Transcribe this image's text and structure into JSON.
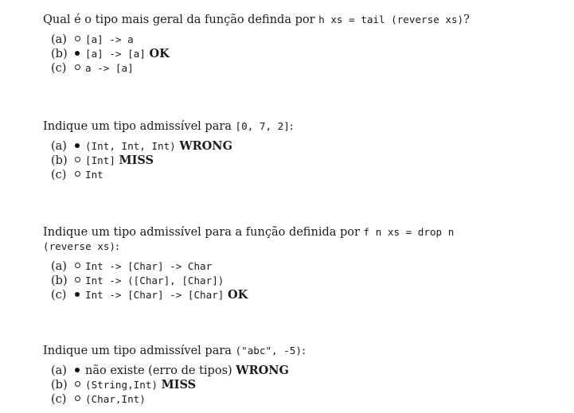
{
  "questions": [
    {
      "stem_text": "Qual é o tipo mais geral da função definda por ",
      "stem_code": "h xs = tail (reverse xs)",
      "stem_tail": "?",
      "options": [
        {
          "label": "(a)",
          "selected": false,
          "code": "[a] -> a",
          "text": "",
          "verdict": ""
        },
        {
          "label": "(b)",
          "selected": true,
          "code": "[a] -> [a]",
          "text": "",
          "verdict": "OK"
        },
        {
          "label": "(c)",
          "selected": false,
          "code": "a -> [a]",
          "text": "",
          "verdict": ""
        }
      ]
    },
    {
      "stem_text": "Indique um tipo admissível para ",
      "stem_code": "[0, 7, 2]",
      "stem_tail": ":",
      "options": [
        {
          "label": "(a)",
          "selected": true,
          "code": "(Int, Int, Int)",
          "text": "",
          "verdict": "WRONG"
        },
        {
          "label": "(b)",
          "selected": false,
          "code": "[Int]",
          "text": "",
          "verdict": "MISS"
        },
        {
          "label": "(c)",
          "selected": false,
          "code": "Int",
          "text": "",
          "verdict": ""
        }
      ]
    },
    {
      "stem_text": "Indique um tipo admissível para a função definida por ",
      "stem_code": "f n xs = drop n (reverse xs)",
      "stem_tail": ":",
      "options": [
        {
          "label": "(a)",
          "selected": false,
          "code": "Int -> [Char] -> Char",
          "text": "",
          "verdict": ""
        },
        {
          "label": "(b)",
          "selected": false,
          "code": "Int -> ([Char], [Char])",
          "text": "",
          "verdict": ""
        },
        {
          "label": "(c)",
          "selected": true,
          "code": "Int -> [Char] -> [Char]",
          "text": "",
          "verdict": "OK"
        }
      ]
    },
    {
      "stem_text": "Indique um tipo admissível para ",
      "stem_code": "(\"abc\", -5)",
      "stem_tail": ":",
      "options": [
        {
          "label": "(a)",
          "selected": true,
          "code": "",
          "text": "não existe (erro de tipos)",
          "verdict": "WRONG"
        },
        {
          "label": "(b)",
          "selected": false,
          "code": "(String,Int)",
          "text": "",
          "verdict": "MISS"
        },
        {
          "label": "(c)",
          "selected": false,
          "code": "(Char,Int)",
          "text": "",
          "verdict": ""
        }
      ]
    }
  ]
}
